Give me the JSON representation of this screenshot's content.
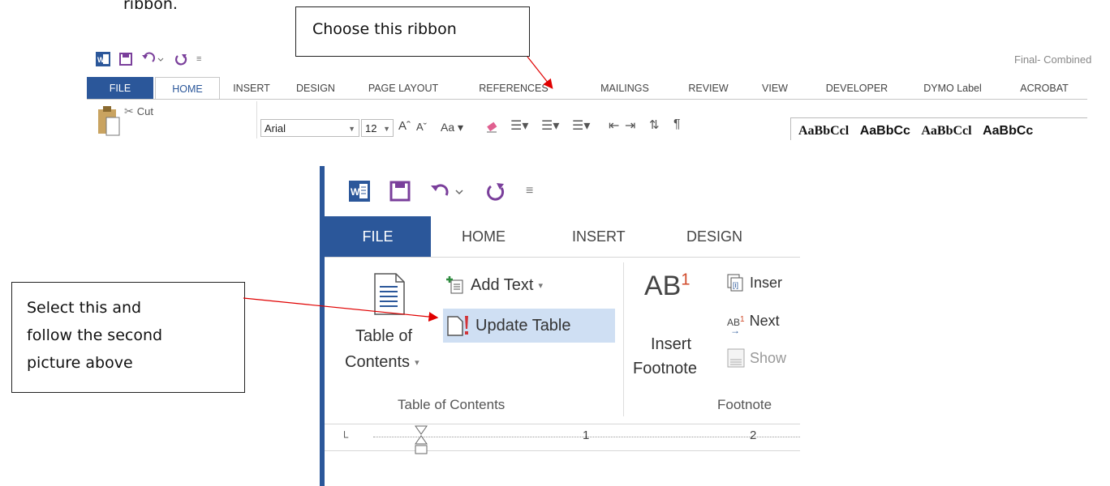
{
  "document": {
    "fragment_text": "ribbon."
  },
  "callouts": {
    "top": {
      "text": "Choose this ribbon"
    },
    "left": {
      "lines": [
        "Select this and",
        "follow the second",
        "picture above"
      ]
    }
  },
  "ribbon_top": {
    "window_title": "Final- Combined",
    "tabs": [
      "FILE",
      "HOME",
      "INSERT",
      "DESIGN",
      "PAGE LAYOUT",
      "REFERENCES",
      "MAILINGS",
      "REVIEW",
      "VIEW",
      "DEVELOPER",
      "DYMO Label",
      "ACROBAT"
    ],
    "clipboard": {
      "cut": "Cut"
    },
    "font": {
      "name": "Arial",
      "size": "12",
      "case_label": "Aa"
    },
    "styles": [
      "AaBbCcl",
      "AaBbCc",
      "AaBbCcl",
      "AaBbCc"
    ],
    "colors": {
      "file_tab": "#2b579a",
      "accent": "#2b579a"
    }
  },
  "ribbon_zoom": {
    "tabs": [
      "FILE",
      "HOME",
      "INSERT",
      "DESIGN"
    ],
    "toc_group": {
      "add_text": "Add Text",
      "update_table": "Update Table",
      "toc_button_line1": "Table of",
      "toc_button_line2": "Contents",
      "label": "Table of Contents"
    },
    "footnotes_group": {
      "insert_footnote_line1": "Insert",
      "insert_footnote_line2": "Footnote",
      "insert_endnote": "Inser",
      "next_footnote": "Next",
      "show_notes": "Show",
      "label": "Footnote",
      "ab_glyph": "AB",
      "superscript": "1"
    },
    "ruler": {
      "mark1": "1",
      "mark2": "2"
    },
    "highlight_color": "#cfdff3"
  }
}
